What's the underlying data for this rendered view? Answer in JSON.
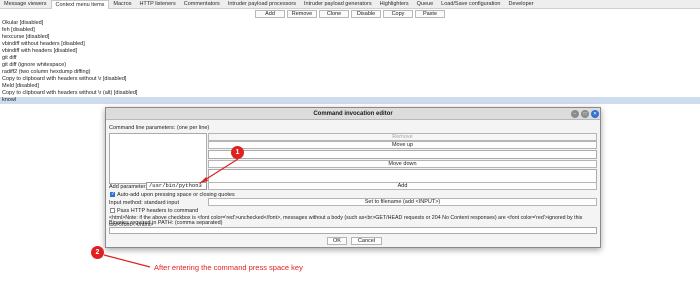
{
  "tabs": [
    "Message viewers",
    "Context menu items",
    "Macros",
    "HTTP listeners",
    "Commentators",
    "Intruder payload processors",
    "Intruder payload generators",
    "Highlighters",
    "Queue",
    "Load/Save configuration",
    "Developer"
  ],
  "active_tab": 1,
  "toolbar": {
    "add": "Add",
    "remove": "Remove",
    "clone": "Clone",
    "disable": "Disable",
    "copy": "Copy",
    "paste": "Paste"
  },
  "list_items": [
    "Okular [disabled]",
    "feh [disabled]",
    "hexcurse [disabled]",
    "vbindiff without headers [disabled]",
    "vbindiff with headers [disabled]",
    "git diff",
    "git diff (ignore whitespace)",
    "radiff2 (two column hexdump diffing)",
    "Copy to clipboard with headers without \\r [disabled]",
    "Meld [disabled]",
    "Copy to clipboard with headers without \\r (alt) [disabled]",
    "knowl"
  ],
  "selected_index": 11,
  "dialog": {
    "title": "Command invocation editor",
    "params_label": "Command line parameters: (one per line)",
    "remove": "Remove",
    "move_up": "Move up",
    "move_down": "Move down",
    "add_param_label": "Add parameter:",
    "add_param_value": "/usr/bin/python3",
    "add": "Add",
    "auto_add_label": "Auto-add upon pressing space or closing quotes",
    "auto_add_checked": true,
    "input_method_label": "Input method: standard input",
    "set_filename": "Set to filename (add <INPUT>)",
    "pass_headers_label": "Pass HTTP headers to command",
    "pass_headers_checked": false,
    "note": "<html>Note: if the above checkbox is <font color='red'>unchecked</font>, messages without a body (such as<br>GET/HEAD requests or 204 No Content responses) are <font color='red'>ignored by this tool</font>.</html>",
    "binaries_label": "Binaries required in PATH: (comma separated)",
    "ok": "OK",
    "cancel": "Cancel"
  },
  "annotations": {
    "marker1": "1",
    "marker2": "2",
    "text": "After entering the command press space key",
    "color": "#e02020"
  }
}
